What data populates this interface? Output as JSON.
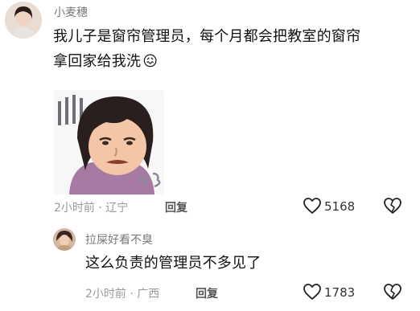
{
  "comment1": {
    "username": "小麦穗",
    "text_line1": "我儿子是窗帘管理员，每个月都会把教室的窗帘",
    "text_line2": "拿回家给我洗",
    "emoji_label": "😖",
    "time": "2小时前",
    "separator": "·",
    "location": "辽宁",
    "reply_label": "回复",
    "like_count": "5168"
  },
  "reply1": {
    "username": "拉屎好看不臭",
    "text": "这么负责的管理员不多见了",
    "time": "2小时前",
    "separator": "·",
    "location": "广西",
    "reply_label": "回复",
    "like_count": "1783"
  },
  "colors": {
    "text": "#111111",
    "meta": "#9a9a9a",
    "username": "#7a7a7a",
    "sticker_hair": "#2a1f1f",
    "sticker_shirt": "#a77aa3"
  }
}
